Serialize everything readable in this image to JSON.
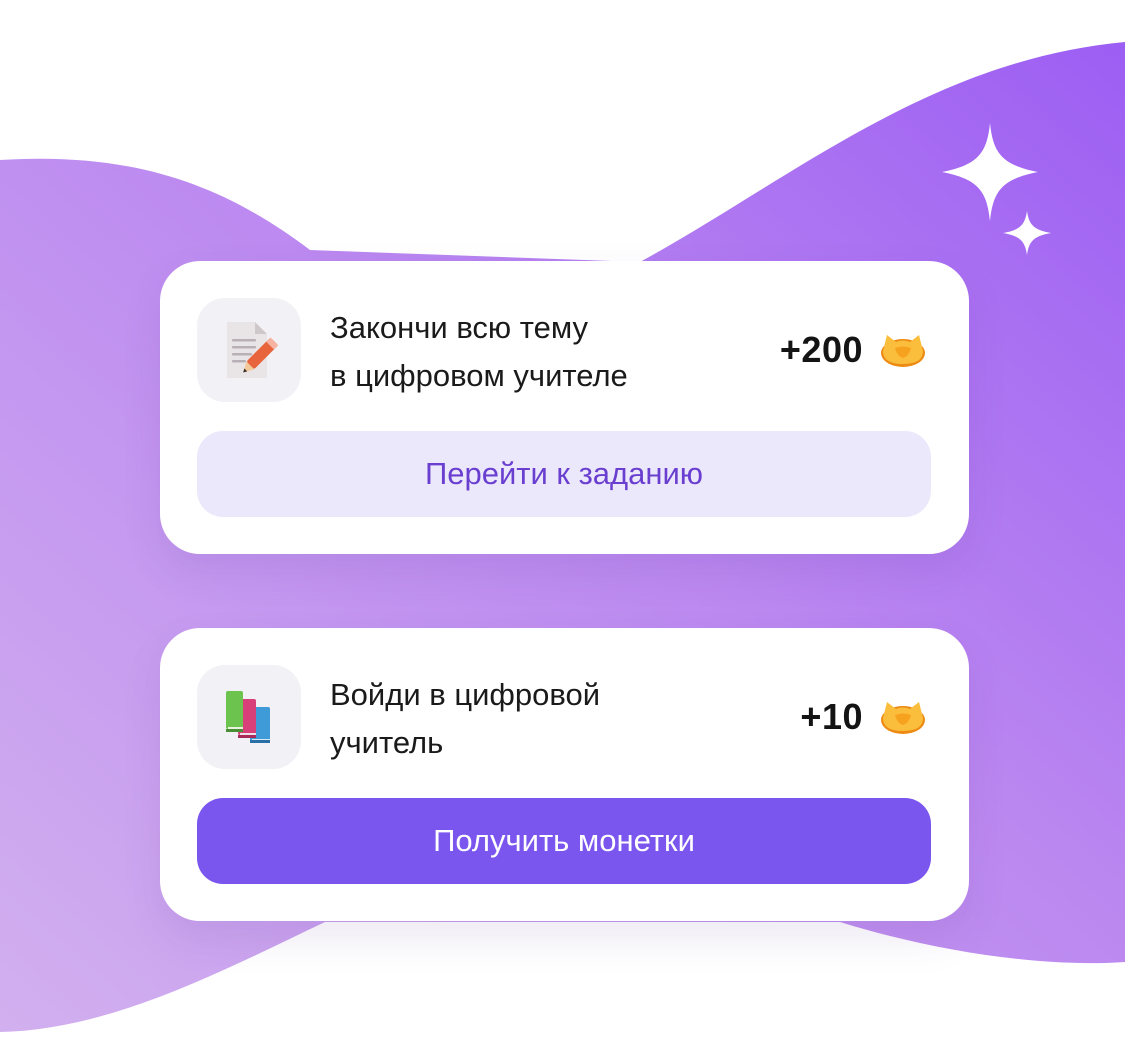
{
  "tasks": [
    {
      "icon": "document-pencil-icon",
      "title_line1": "Закончи всю тему",
      "title_line2": "в цифровом учителе",
      "reward": "+200",
      "reward_icon": "coin-icon",
      "button_label": "Перейти к заданию"
    },
    {
      "icon": "books-icon",
      "title_line1": "Войди в цифровой",
      "title_line2": "учитель",
      "reward": "+10",
      "reward_icon": "coin-icon",
      "button_label": "Получить монетки"
    }
  ],
  "colors": {
    "accent": "#7a55ee",
    "secondary_button_bg": "#ebe8fc",
    "secondary_button_text": "#6a3fd0",
    "background_wave_start": "#d1aef0",
    "background_wave_end": "#9d60f2",
    "coin": "#f5a623"
  }
}
